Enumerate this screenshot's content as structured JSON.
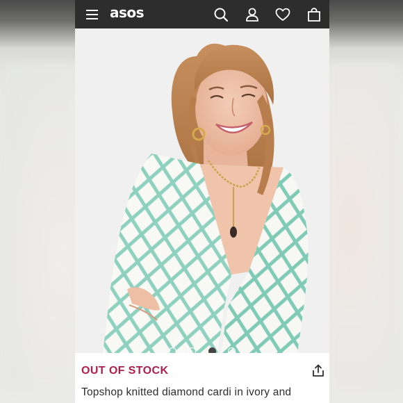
{
  "header": {
    "logo_text": "asos",
    "icons": [
      "menu-icon",
      "search-icon",
      "account-icon",
      "wishlist-heart-icon",
      "bag-icon"
    ]
  },
  "gallery": {
    "slide_count": 4,
    "active_slide": 3
  },
  "product": {
    "stock_status": "OUT OF STOCK",
    "title": "Topshop knitted diamond cardi in ivory and"
  },
  "colors": {
    "header_bg": "#2d2d2d",
    "stock_red": "#b01f4c",
    "text": "#2d2d2d",
    "knit_teal": "#7fcbb6",
    "knit_ivory": "#f7f7f4"
  }
}
